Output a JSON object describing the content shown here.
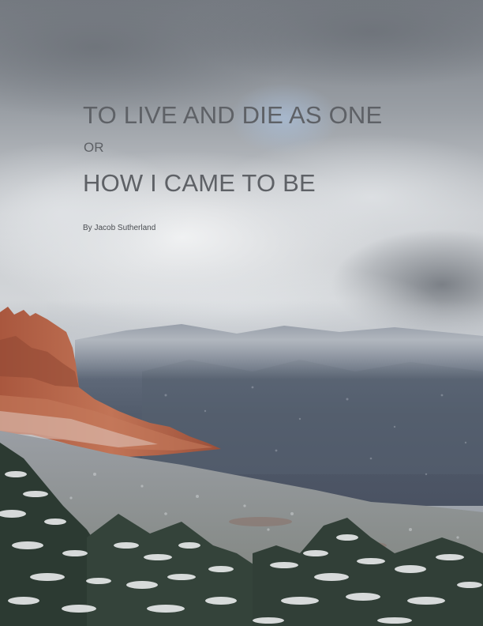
{
  "cover": {
    "title_line_1": "TO LIVE AND DIE AS ONE",
    "title_connector": "OR",
    "title_line_2": "HOW I CAME TO BE",
    "byline": "By Jacob Sutherland"
  },
  "colors": {
    "title_text": "#5e6166",
    "byline_text": "#4a4d52",
    "sky_top": "#7b8087",
    "cloud_light": "#e4e6e8",
    "red_rock": "#b4654a",
    "mountain_blue": "#5b6474",
    "snowy_pine": "#2c3a32"
  }
}
